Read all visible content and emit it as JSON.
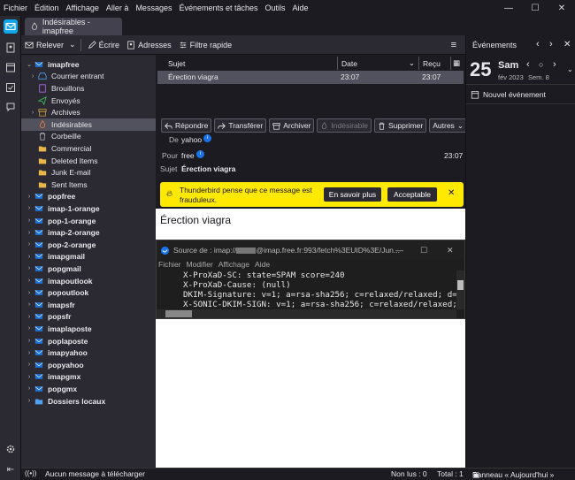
{
  "menubar": {
    "items": [
      "Fichier",
      "Édition",
      "Affichage",
      "Aller à",
      "Messages",
      "Événements et tâches",
      "Outils",
      "Aide"
    ]
  },
  "tab": {
    "label": "Indésirables - imapfree"
  },
  "toolbar": {
    "get_messages": "Relever",
    "write": "Écrire",
    "address_book": "Adresses",
    "quick_filter": "Filtre rapide"
  },
  "folders": [
    {
      "label": "imapfree",
      "bold": true,
      "level": 0,
      "chev": "v",
      "icon": "account"
    },
    {
      "label": "Courrier entrant",
      "level": 1,
      "chev": ">",
      "icon": "inbox"
    },
    {
      "label": "Brouillons",
      "level": 1,
      "chev": "",
      "icon": "drafts"
    },
    {
      "label": "Envoyés",
      "level": 1,
      "chev": "",
      "icon": "sent"
    },
    {
      "label": "Archives",
      "level": 1,
      "chev": ">",
      "icon": "archive"
    },
    {
      "label": "Indésirables",
      "level": 1,
      "chev": "",
      "icon": "junk",
      "selected": true
    },
    {
      "label": "Corbeille",
      "level": 1,
      "chev": "",
      "icon": "trash"
    },
    {
      "label": "Commercial",
      "level": 1,
      "chev": "",
      "icon": "folder"
    },
    {
      "label": "Deleted Items",
      "level": 1,
      "chev": "",
      "icon": "folder"
    },
    {
      "label": "Junk E-mail",
      "level": 1,
      "chev": "",
      "icon": "folder"
    },
    {
      "label": "Sent Items",
      "level": 1,
      "chev": "",
      "icon": "folder"
    },
    {
      "label": "popfree",
      "bold": true,
      "level": 0,
      "chev": ">",
      "icon": "account"
    },
    {
      "label": "imap-1-orange",
      "bold": true,
      "level": 0,
      "chev": ">",
      "icon": "account"
    },
    {
      "label": "pop-1-orange",
      "bold": true,
      "level": 0,
      "chev": ">",
      "icon": "account"
    },
    {
      "label": "imap-2-orange",
      "bold": true,
      "level": 0,
      "chev": ">",
      "icon": "account"
    },
    {
      "label": "pop-2-orange",
      "bold": true,
      "level": 0,
      "chev": ">",
      "icon": "account"
    },
    {
      "label": "imapgmail",
      "bold": true,
      "level": 0,
      "chev": ">",
      "icon": "account"
    },
    {
      "label": "popgmail",
      "bold": true,
      "level": 0,
      "chev": ">",
      "icon": "account"
    },
    {
      "label": "imapoutlook",
      "bold": true,
      "level": 0,
      "chev": ">",
      "icon": "account"
    },
    {
      "label": "popoutlook",
      "bold": true,
      "level": 0,
      "chev": ">",
      "icon": "account"
    },
    {
      "label": "imapsfr",
      "bold": true,
      "level": 0,
      "chev": ">",
      "icon": "account"
    },
    {
      "label": "popsfr",
      "bold": true,
      "level": 0,
      "chev": ">",
      "icon": "account"
    },
    {
      "label": "imaplaposte",
      "bold": true,
      "level": 0,
      "chev": ">",
      "icon": "account"
    },
    {
      "label": "poplaposte",
      "bold": true,
      "level": 0,
      "chev": ">",
      "icon": "account"
    },
    {
      "label": "imapyahoo",
      "bold": true,
      "level": 0,
      "chev": ">",
      "icon": "account"
    },
    {
      "label": "popyahoo",
      "bold": true,
      "level": 0,
      "chev": ">",
      "icon": "account"
    },
    {
      "label": "imapgmx",
      "bold": true,
      "level": 0,
      "chev": ">",
      "icon": "account"
    },
    {
      "label": "popgmx",
      "bold": true,
      "level": 0,
      "chev": ">",
      "icon": "account"
    },
    {
      "label": "Dossiers locaux",
      "bold": true,
      "level": 0,
      "chev": ">",
      "icon": "local"
    }
  ],
  "thread": {
    "columns": {
      "subject": "Sujet",
      "date": "Date",
      "received": "Reçu"
    },
    "rows": [
      {
        "subject": "Érection viagra",
        "date": "23:07",
        "received": "23:07"
      }
    ]
  },
  "message": {
    "actions": {
      "reply": "Répondre",
      "forward": "Transférer",
      "archive": "Archiver",
      "junk": "Indésirable",
      "delete": "Supprimer",
      "other": "Autres"
    },
    "from_label": "De",
    "from": "yahoo",
    "to_label": "Pour",
    "to": "free",
    "time": "23:07",
    "subject_label": "Sujet",
    "subject": "Érection viagra",
    "body_title": "Érection viagra"
  },
  "spam_notice": {
    "text_line1": "Thunderbird pense que ce message est",
    "text_line2": "frauduleux.",
    "learn_more": "En savoir plus",
    "accept": "Acceptable"
  },
  "source_window": {
    "title_prefix": "Source de : imap://",
    "title_suffix": "@imap.free.fr:993/fetch%3EUID%3E/Jun...",
    "menu": [
      "Fichier",
      "Modifier",
      "Affichage",
      "Aide"
    ],
    "lines": [
      "X-ProXaD-SC: state=SPAM score=240",
      "X-ProXaD-Cause: (null)",
      "DKIM-Signature: v=1; a=rsa-sha256; c=relaxed/relaxed; d=",
      "X-SONIC-DKIM-SIGN: v=1; a=rsa-sha256; c=relaxed/relaxed;"
    ]
  },
  "calendar": {
    "title": "Événements",
    "day": "25",
    "weekday": "Sam",
    "month_year": "fév 2023",
    "week": "Sem. 8",
    "new_event": "Nouvel événement"
  },
  "statusbar": {
    "left": "Aucun message à télécharger",
    "unread": "Non lus : 0",
    "total": "Total : 1",
    "panel": "Panneau « Aujourd'hui »"
  },
  "colors": {
    "accent": "#0ea5e9",
    "spam_bar": "#ffe900",
    "selection": "#52525e"
  }
}
